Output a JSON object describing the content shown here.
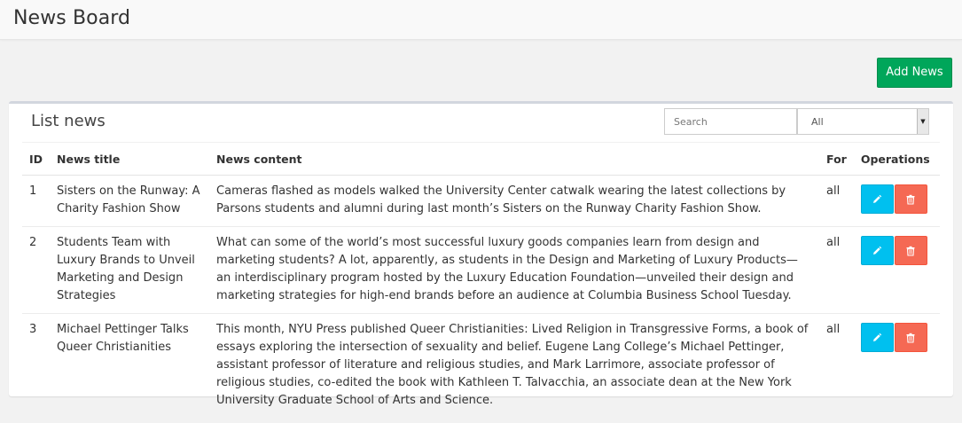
{
  "header": {
    "title": "News Board"
  },
  "toolbar": {
    "add_label": "Add News"
  },
  "panel": {
    "title": "List news",
    "search": {
      "placeholder": "Search",
      "value": ""
    },
    "filter": {
      "selected": "All"
    }
  },
  "table": {
    "headers": {
      "id": "ID",
      "title": "News title",
      "content": "News content",
      "for": "For",
      "operations": "Operations"
    },
    "rows": [
      {
        "id": "1",
        "title": "Sisters on the Runway: A Charity Fashion Show",
        "content": "Cameras flashed as models walked the University Center catwalk wearing the latest collections by Parsons students and alumni during last month’s Sisters on the Runway Charity Fashion Show.",
        "for": "all"
      },
      {
        "id": "2",
        "title": "Students Team with Luxury Brands to Unveil Marketing and Design Strategies",
        "content": "What can some of the world’s most successful luxury goods companies learn from design and marketing students? A lot, apparently, as students in the Design and Marketing of Luxury Products—an interdisciplinary program hosted by the Luxury Education Foundation—unveiled their design and marketing strategies for high-end brands before an audience at Columbia Business School Tuesday.",
        "for": "all"
      },
      {
        "id": "3",
        "title": "Michael Pettinger Talks Queer Christianities",
        "content": "This month, NYU Press published Queer Christianities: Lived Religion in Transgressive Forms, a book of essays exploring the intersection of sexuality and belief. Eugene Lang College’s Michael Pettinger, assistant professor of literature and religious studies, and Mark Larrimore, associate professor of religious studies, co-edited the book with Kathleen T. Talvacchia, an associate dean at the New York University Graduate School of Arts and Science.",
        "for": "all"
      }
    ]
  },
  "colors": {
    "add_button": "#00a65a",
    "edit_button": "#00c0ef",
    "delete_button": "#f56954"
  },
  "icons": {
    "edit": "pencil-icon",
    "delete": "trash-icon"
  }
}
